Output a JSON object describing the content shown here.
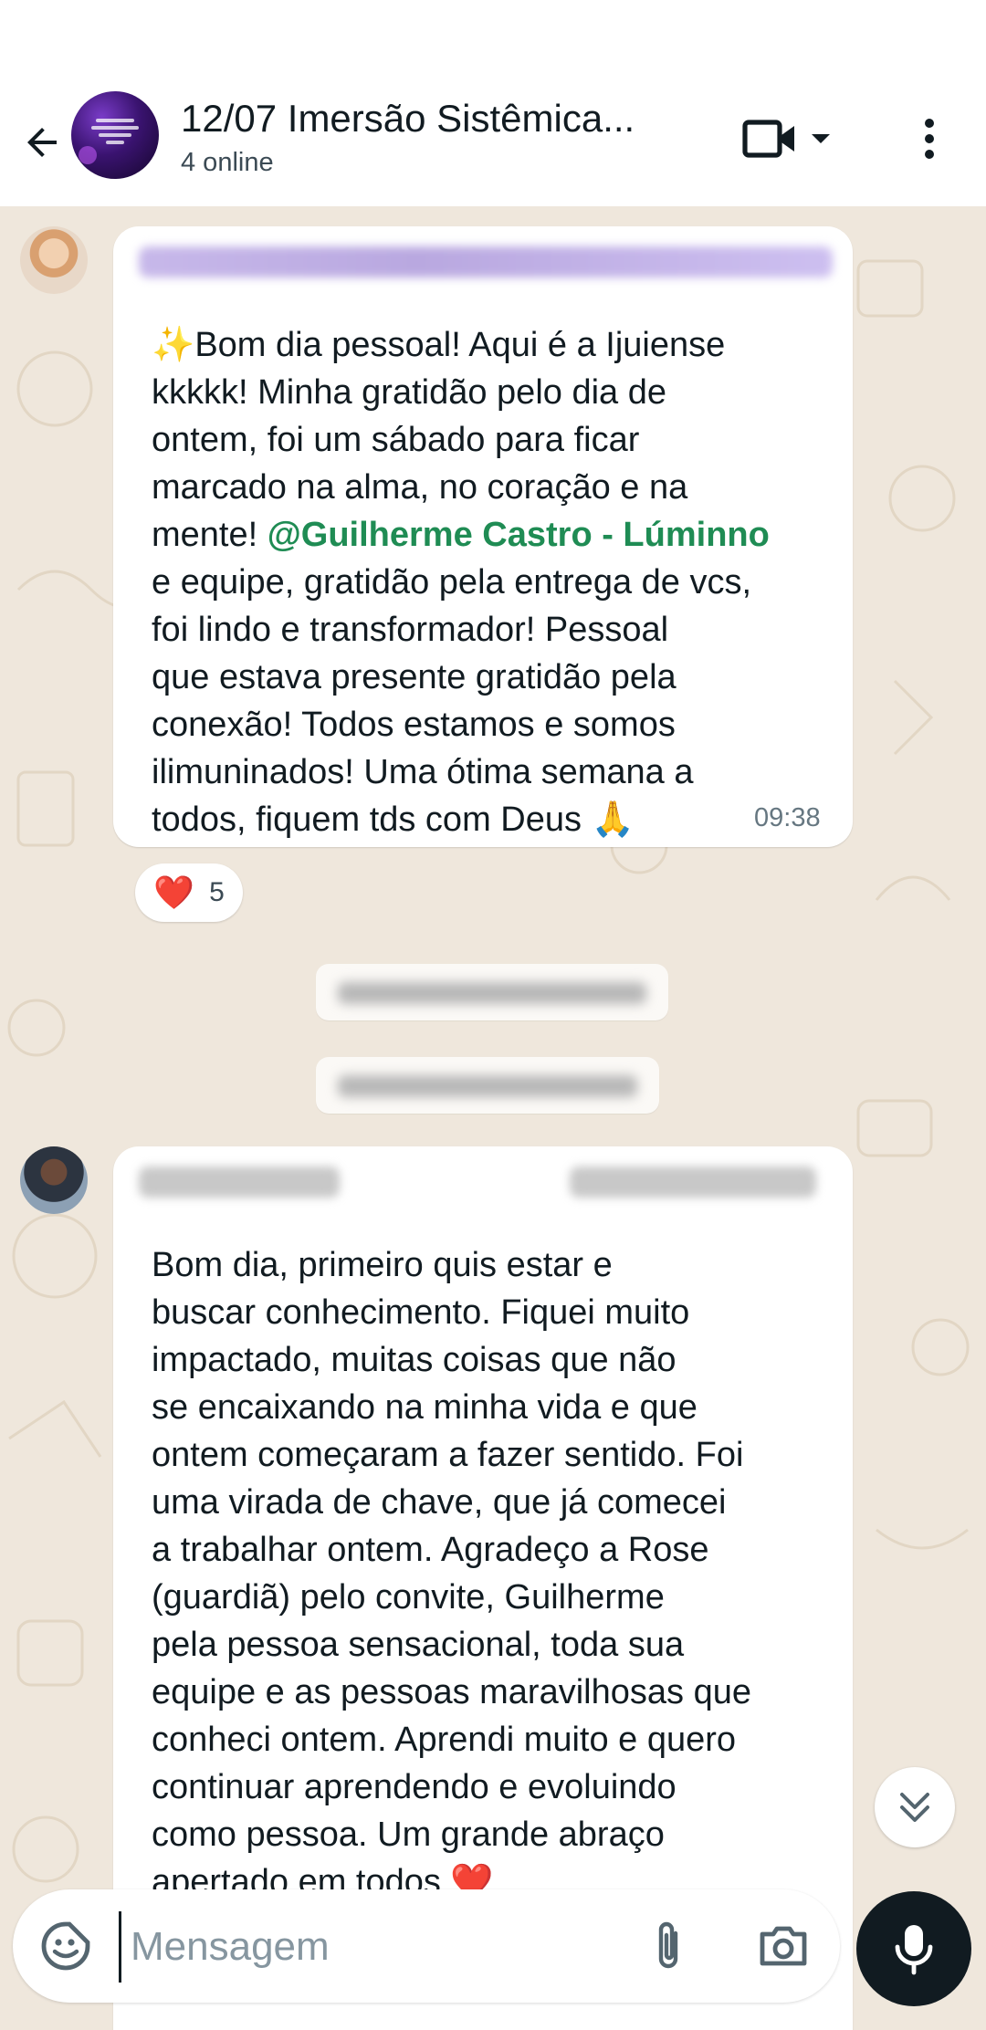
{
  "header": {
    "title": "12/07 Imersão Sistêmica...",
    "subtitle": "4 online",
    "back_icon": "arrow-left-icon",
    "video_icon": "video-camera-icon",
    "menu_icon": "more-vert-icon"
  },
  "messages": [
    {
      "text_before_mention": "✨Bom dia pessoal! Aqui é a Ijuiense\nkkkkk! Minha gratidão pelo dia de\nontem, foi um sábado para ficar\nmarcado na alma, no coração e na\nmente! ",
      "mention": "@Guilherme Castro - Lúminno",
      "text_after_mention": "\ne equipe, gratidão pela entrega de vcs,\nfoi lindo e transformador! Pessoal\nque estava presente gratidão pela\nconexão! Todos estamos e somos\nilimuninados! Uma ótima semana a\ntodos, fiquem tds com Deus 🙏",
      "time": "09:38",
      "reaction_emoji": "❤️",
      "reaction_count": "5"
    },
    {
      "text": "Bom dia, primeiro quis estar   e\nbuscar conhecimento. Fiquei muito\nimpactado, muitas coisas que não\nse encaixando na minha vida e que\nontem começaram a fazer sentido. Foi\numa virada de chave, que já comecei\na trabalhar ontem. Agradeço a Rose\n(guardiã) pelo convite, Guilherme\npela pessoa sensacional, toda sua\nequipe e as pessoas maravilhosas que\nconheci ontem. Aprendi muito e quero\ncontinuar aprendendo e evoluindo\ncomo pessoa. Um grande abraço\napertado em todos ❤️"
    }
  ],
  "composer": {
    "placeholder": "Mensagem",
    "value": ""
  },
  "colors": {
    "wallpaper": "#efe7dc",
    "mention": "#1f8c54",
    "bubble": "#ffffff",
    "mic_button": "#111b21"
  }
}
